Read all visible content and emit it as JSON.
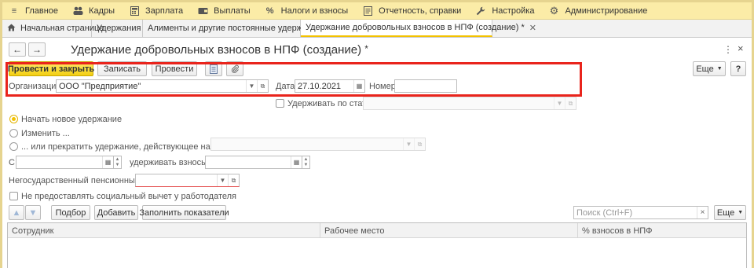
{
  "menu": [
    {
      "icon": "menu-lines-icon",
      "glyph": "≡",
      "label": "Главное"
    },
    {
      "icon": "users-icon",
      "glyph": "👥",
      "label": "Кадры"
    },
    {
      "icon": "calculator-icon",
      "glyph": "▦",
      "label": "Зарплата"
    },
    {
      "icon": "wallet-icon",
      "glyph": "▬",
      "label": "Выплаты"
    },
    {
      "icon": "percent-icon",
      "glyph": "%",
      "label": "Налоги и взносы"
    },
    {
      "icon": "report-icon",
      "glyph": "▤",
      "label": "Отчетность, справки"
    },
    {
      "icon": "wrench-icon",
      "glyph": "🔧",
      "label": "Настройка"
    },
    {
      "icon": "gear-icon",
      "glyph": "⚙",
      "label": "Администрирование"
    }
  ],
  "tabs": [
    {
      "label": "Начальная страница",
      "home": true
    },
    {
      "label": "Удержания"
    },
    {
      "label": "Алименты и другие постоянные удержания",
      "closable": true
    },
    {
      "label": "Удержание добровольных взносов в НПФ (создание) *",
      "closable": true,
      "active": true
    }
  ],
  "form": {
    "title": "Удержание добровольных взносов в НПФ (создание)",
    "title_star": "*",
    "more_glyph": "⋮",
    "close_glyph": "×"
  },
  "toolbar": {
    "post_close": "Провести и закрыть",
    "save": "Записать",
    "post": "Провести",
    "more": "Еще",
    "help": "?"
  },
  "header_fields": {
    "org_label": "Организация:",
    "org_value": "ООО \"Предприятие\"",
    "date_label": "Дата:",
    "date_value": "27.10.2021",
    "number_label": "Номер:",
    "number_value": "",
    "by_article_label": "Удерживать по статье:",
    "by_article_value": ""
  },
  "options": {
    "start_new": "Начать новое удержание",
    "change": "Изменить ...",
    "or_stop": "... или прекратить удержание, действующее на основании",
    "selected": "start_new"
  },
  "period": {
    "from_label": "С:",
    "from_value": "",
    "to_label": "удерживать взносы по:",
    "to_value": ""
  },
  "fund": {
    "label": "Негосударственный пенсионный фонд:",
    "value": ""
  },
  "social_deduction": {
    "label": "Не предоставлять социальный вычет у работодателя",
    "checked": false
  },
  "table_toolbar": {
    "pick": "Подбор",
    "add": "Добавить",
    "fill": "Заполнить показатели",
    "search_placeholder": "Поиск (Ctrl+F)",
    "more": "Еще"
  },
  "table": {
    "columns": [
      "Сотрудник",
      "Рабочее место",
      "% взносов в НПФ"
    ]
  },
  "colors": {
    "menu_bg": "#fbeca7",
    "primary_button": "#f3cf12",
    "highlight_box": "#e9241c",
    "active_tab_underline": "#f3c200"
  }
}
